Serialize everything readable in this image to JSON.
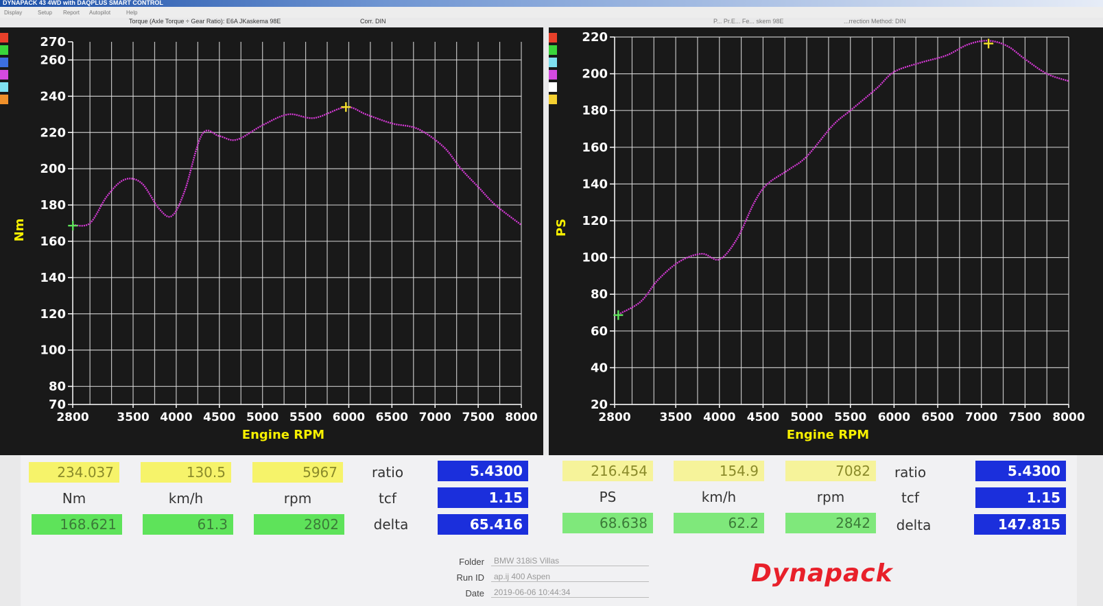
{
  "window": {
    "title": "DYNAPACK 43 4WD with DAQPLUS SMART CONTROL"
  },
  "menu": [
    "Display",
    "Setup",
    "Report",
    "Autopilot",
    "Help"
  ],
  "subtitles": {
    "left": "Torque (Axle Torque ÷ Gear Ratio): E6A JKaskema 98E",
    "left_corr": "Corr. DIN",
    "right_a": "P... Pr.E... Fe... skem 98E",
    "right_b": "...rrection Method: DIN"
  },
  "legend_colors": [
    "#e8402a",
    "#39d63b",
    "#3c6fe0",
    "#d54ae0",
    "#7ee0f0",
    "#f0902a"
  ],
  "legend_colors_right": [
    "#e8402a",
    "#39d63b",
    "#7ee0f0",
    "#d54ae0",
    "#ffffff",
    "#f5d030"
  ],
  "colors": {
    "curve": "#d63ad6",
    "grid": "#e0e0e0",
    "marker": "#f5e02a",
    "start_marker": "#5ee35a"
  },
  "chart_data": [
    {
      "type": "line",
      "title": "",
      "xlabel": "Engine RPM",
      "ylabel": "Nm",
      "xlim": [
        2800,
        8000
      ],
      "ylim": [
        70,
        270
      ],
      "xticks": [
        2800,
        3500,
        4000,
        4500,
        5000,
        5500,
        6000,
        6500,
        7000,
        7500,
        8000
      ],
      "yticks": [
        70,
        80,
        100,
        120,
        140,
        160,
        180,
        200,
        220,
        240,
        260,
        270
      ],
      "series": [
        {
          "x": [
            2800,
            3000,
            3200,
            3400,
            3600,
            3800,
            3950,
            4100,
            4300,
            4500,
            4700,
            5000,
            5300,
            5600,
            5967,
            6200,
            6500,
            6800,
            7100,
            7300,
            7500,
            7700,
            8000
          ],
          "y": [
            169,
            170,
            185,
            194,
            192,
            178,
            174,
            188,
            219,
            218,
            216,
            224,
            230,
            228,
            234,
            230,
            225,
            222,
            212,
            200,
            190,
            180,
            169
          ]
        }
      ],
      "markers": [
        {
          "x": 2802,
          "y": 168.621,
          "kind": "start"
        },
        {
          "x": 5967,
          "y": 234.037,
          "kind": "peak"
        }
      ]
    },
    {
      "type": "line",
      "title": "",
      "xlabel": "Engine RPM",
      "ylabel": "PS",
      "xlim": [
        2800,
        8000
      ],
      "ylim": [
        20,
        220
      ],
      "xticks": [
        2800,
        3500,
        4000,
        4500,
        5000,
        5500,
        6000,
        6500,
        7000,
        7500,
        8000
      ],
      "yticks": [
        20,
        40,
        60,
        80,
        100,
        120,
        140,
        160,
        180,
        200,
        220
      ],
      "series": [
        {
          "x": [
            2842,
            3100,
            3300,
            3550,
            3800,
            4000,
            4200,
            4400,
            4550,
            4800,
            5000,
            5300,
            5500,
            5800,
            6000,
            6300,
            6600,
            6850,
            7082,
            7300,
            7500,
            7750,
            8000
          ],
          "y": [
            69,
            76,
            88,
            98,
            102,
            99,
            110,
            130,
            140,
            148,
            155,
            172,
            180,
            192,
            201,
            206,
            210,
            216,
            218,
            215,
            208,
            200,
            196
          ]
        }
      ],
      "markers": [
        {
          "x": 2842,
          "y": 68.638,
          "kind": "start"
        },
        {
          "x": 7082,
          "y": 216.454,
          "kind": "peak"
        }
      ]
    }
  ],
  "readouts": {
    "left": {
      "peak": {
        "torque": "234.037",
        "speed": "130.5",
        "rpm": "5967"
      },
      "units": {
        "torque": "Nm",
        "speed": "km/h",
        "rpm": "rpm"
      },
      "start": {
        "torque": "168.621",
        "speed": "61.3",
        "rpm": "2802"
      },
      "labels": {
        "ratio": "ratio",
        "tcf": "tcf",
        "delta": "delta"
      },
      "values": {
        "ratio": "5.4300",
        "tcf": "1.15",
        "delta": "65.416"
      }
    },
    "right": {
      "peak": {
        "power": "216.454",
        "speed": "154.9",
        "rpm": "7082"
      },
      "units": {
        "power": "PS",
        "speed": "km/h",
        "rpm": "rpm"
      },
      "start": {
        "power": "68.638",
        "speed": "62.2",
        "rpm": "2842"
      },
      "labels": {
        "ratio": "ratio",
        "tcf": "tcf",
        "delta": "delta"
      },
      "values": {
        "ratio": "5.4300",
        "tcf": "1.15",
        "delta": "147.815"
      }
    }
  },
  "meta": {
    "folder_label": "Folder",
    "folder_value": "BMW 318iS Villas",
    "runid_label": "Run ID",
    "runid_value": "ap.ij 400 Aspen",
    "date_label": "Date",
    "date_value": "2019-06-06 10:44:34"
  },
  "brand": "Dynapack"
}
